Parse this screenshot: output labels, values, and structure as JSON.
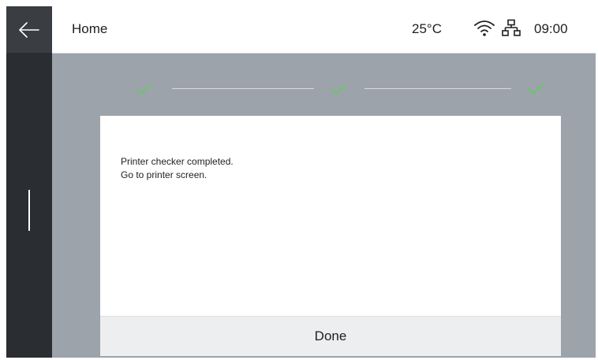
{
  "header": {
    "title": "Home",
    "temperature": "25°C",
    "time": "09:00"
  },
  "icons": {
    "back": "back-arrow-icon",
    "wifi": "wifi-icon",
    "network": "network-icon",
    "step_done": "checkmark-icon"
  },
  "stepper": {
    "steps_completed": 3,
    "steps_total": 3
  },
  "dialog": {
    "line1": "Printer checker completed.",
    "line2": "Go to printer screen.",
    "done_label": "Done"
  },
  "colors": {
    "check": "#6cc46c",
    "sidebar": "#2a2d31",
    "overlay": "#9da3ab"
  }
}
